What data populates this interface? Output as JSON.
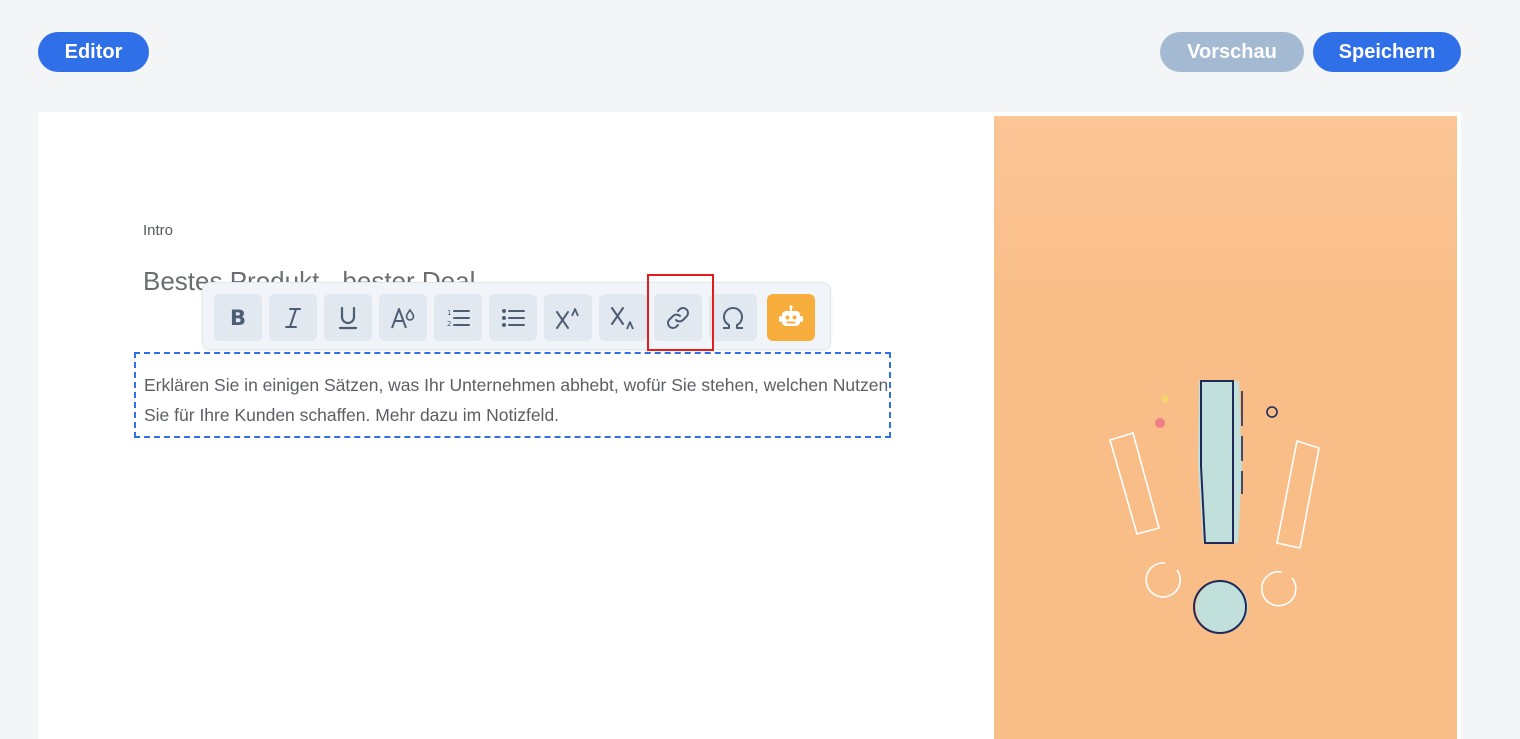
{
  "header": {
    "editor_label": "Editor",
    "preview_label": "Vorschau",
    "save_label": "Speichern"
  },
  "content": {
    "section_label": "Intro",
    "headline": "Bestes Produkt - bester Deal",
    "body_text": "Erklären Sie in einigen Sätzen, was Ihr Unternehmen abhebt, wofür Sie stehen, welchen Nutzen Sie für Ihre Kunden schaffen. Mehr dazu im Notizfeld."
  },
  "toolbar": {
    "buttons": [
      {
        "name": "bold",
        "icon": "bold-icon"
      },
      {
        "name": "italic",
        "icon": "italic-icon"
      },
      {
        "name": "underline",
        "icon": "underline-icon"
      },
      {
        "name": "font-size",
        "icon": "font-size-icon"
      },
      {
        "name": "ordered-list",
        "icon": "ordered-list-icon"
      },
      {
        "name": "bullet-list",
        "icon": "bullet-list-icon"
      },
      {
        "name": "superscript",
        "icon": "superscript-icon"
      },
      {
        "name": "subscript",
        "icon": "subscript-icon"
      },
      {
        "name": "link",
        "icon": "link-icon"
      },
      {
        "name": "special-character",
        "icon": "omega-icon"
      },
      {
        "name": "ai-assistant",
        "icon": "robot-icon"
      }
    ]
  },
  "colors": {
    "primary": "#2f6fe8",
    "preview_disabled": "#a4bad3",
    "ai_accent": "#f7ae3d",
    "highlight": "#e41c1c",
    "image_background": "#f9bd88"
  }
}
